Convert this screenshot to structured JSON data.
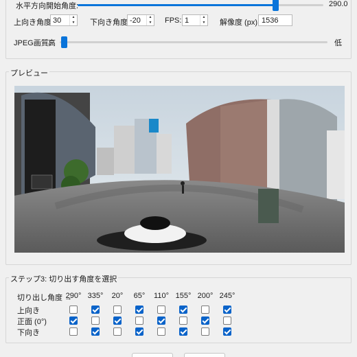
{
  "settings": {
    "pitch_start_label": "水平方向開始角度:",
    "pitch_start_value": "290.0",
    "pitch_start_fraction": 0.805,
    "up_angle_label": "上向き角度:",
    "up_angle_value": "30",
    "down_angle_label": "下向き角度:",
    "down_angle_value": "-20",
    "fps_label": "FPS:",
    "fps_value": "1",
    "resolution_label": "解像度 (px):",
    "resolution_value": "1536",
    "jpeg_label": "JPEG画質:",
    "jpeg_high": "高",
    "jpeg_low": "低",
    "jpeg_fraction": 0.0
  },
  "preview": {
    "title": "プレビュー"
  },
  "step3": {
    "title": "ステップ3: 切り出す角度を選択",
    "header_label": "切り出し角度 →",
    "angles": [
      "290°",
      "335°",
      "20°",
      "65°",
      "110°",
      "155°",
      "200°",
      "245°"
    ],
    "rows": [
      {
        "label": "上向き",
        "checks": [
          false,
          true,
          false,
          true,
          false,
          true,
          false,
          true
        ]
      },
      {
        "label": "正面 (0°)",
        "checks": [
          true,
          false,
          true,
          false,
          true,
          false,
          true,
          false
        ]
      },
      {
        "label": "下向き",
        "checks": [
          false,
          true,
          false,
          true,
          false,
          true,
          false,
          true
        ]
      }
    ]
  },
  "colors": {
    "accent": "#0a74da",
    "checkbox_on": "#0a63c9"
  }
}
